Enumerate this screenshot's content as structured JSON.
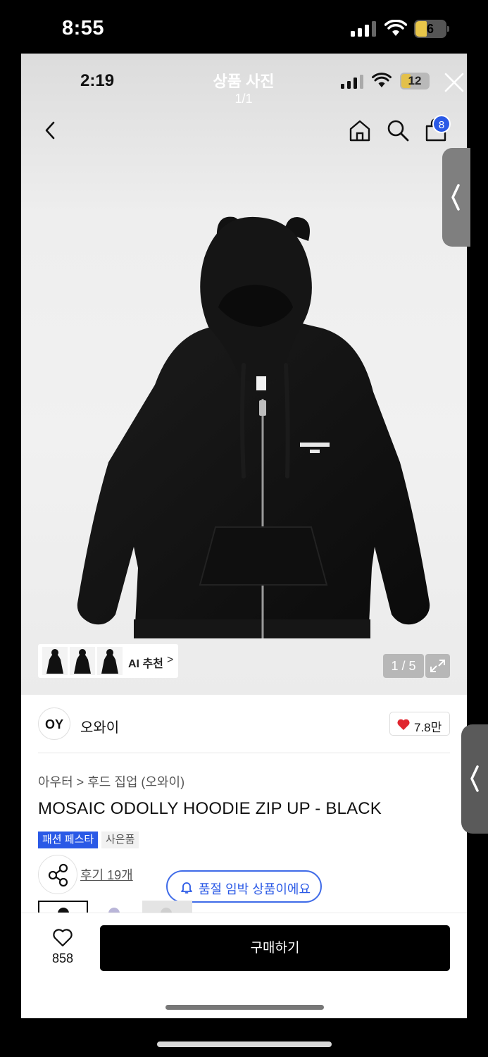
{
  "outer_status": {
    "time": "8:55",
    "battery": "6"
  },
  "inner_status": {
    "time": "2:19",
    "battery": "12"
  },
  "viewer": {
    "title": "상품 사진",
    "count": "1/1"
  },
  "header": {
    "cart_badge": "8"
  },
  "photo": {
    "ai_label": "AI 추천",
    "ai_chevron": ">",
    "page_indicator": "1 / 5"
  },
  "seller": {
    "logo_text": "OY",
    "name": "오와이",
    "likes": "7.8만"
  },
  "product": {
    "breadcrumb": "아우터 > 후드 집업 (오와이)",
    "title": "MOSAIC ODOLLY HOODIE ZIP UP - BLACK",
    "tags": [
      "패션 페스타",
      "사은품"
    ],
    "review_link": "후기 19개",
    "soldout_notice": "품절 임박 상품이에요"
  },
  "bottom_bar": {
    "wish_count": "858",
    "buy_label": "구매하기"
  },
  "colors": {
    "accent": "#2a59e6",
    "like_red": "#e0262f",
    "buy_bg": "#000000"
  }
}
